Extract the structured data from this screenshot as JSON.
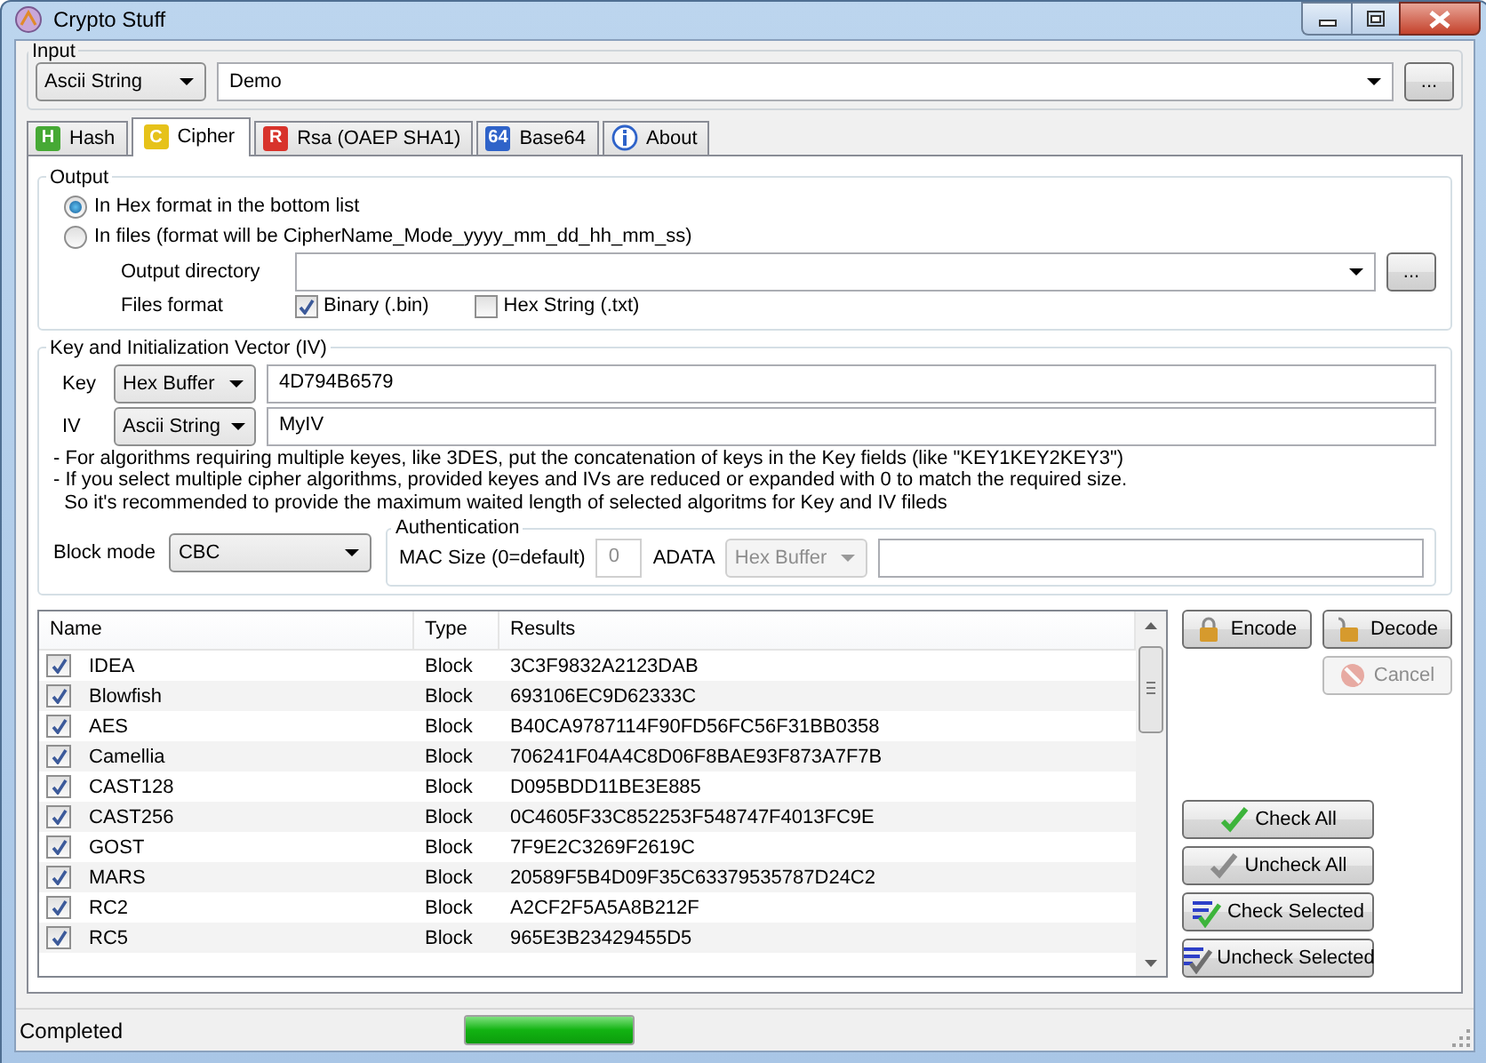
{
  "window": {
    "title": "Crypto Stuff"
  },
  "input": {
    "title": "Input",
    "format": "Ascii String",
    "value": "Demo",
    "browse": "..."
  },
  "tabs": [
    {
      "label": "Hash",
      "badge": "H",
      "kind": "letter",
      "color": "#46a935",
      "selected": false
    },
    {
      "label": "Cipher",
      "badge": "C",
      "kind": "letter",
      "color": "#e6c21a",
      "selected": true
    },
    {
      "label": "Rsa (OAEP SHA1)",
      "badge": "R",
      "kind": "letter",
      "color": "#d8332b",
      "selected": false
    },
    {
      "label": "Base64",
      "badge": "64",
      "kind": "letter",
      "color": "#2f63c9",
      "selected": false
    },
    {
      "label": "About",
      "kind": "info",
      "color": "#2f63c9",
      "selected": false
    }
  ],
  "output": {
    "title": "Output",
    "options": [
      {
        "label": "In Hex format in the bottom list",
        "selected": true
      },
      {
        "label": "In files (format will be CipherName_Mode_yyyy_mm_dd_hh_mm_ss)",
        "selected": false
      }
    ],
    "directory_label": "Output directory",
    "browse": "...",
    "files_format_label": "Files format",
    "formats": [
      {
        "label": "Binary (.bin)",
        "checked": true
      },
      {
        "label": "Hex String (.txt)",
        "checked": false
      }
    ]
  },
  "key_iv": {
    "title": "Key and Initialization Vector (IV)",
    "rows": [
      {
        "label": "Key",
        "format": "Hex Buffer",
        "value": "4D794B6579"
      },
      {
        "label": "IV",
        "format": "Ascii String",
        "value": "MyIV"
      }
    ],
    "notes": [
      "- For algorithms requiring multiple keyes, like 3DES, put the concatenation of keys in the Key fields (like \"KEY1KEY2KEY3\")",
      "- If you select multiple cipher algorithms, provided keyes and IVs are reduced or expanded with 0 to match the required size.",
      "  So it's recommended to provide the maximum waited length of selected algoritms for Key and IV fileds"
    ],
    "block_mode_label": "Block mode",
    "block_mode": "CBC",
    "authentication": {
      "title": "Authentication",
      "mac_label": "MAC Size (0=default)",
      "mac_value": "0",
      "adata_label": "ADATA",
      "adata_format": "Hex Buffer",
      "disabled": true
    }
  },
  "table": {
    "columns": [
      "Name",
      "Type",
      "Results"
    ],
    "rows": [
      {
        "name": "IDEA",
        "checked": true,
        "type": "Block",
        "result": "3C3F9832A2123DAB"
      },
      {
        "name": "Blowfish",
        "checked": true,
        "type": "Block",
        "result": "693106EC9D62333C"
      },
      {
        "name": "AES",
        "checked": true,
        "type": "Block",
        "result": "B40CA9787114F90FD56FC56F31BB0358"
      },
      {
        "name": "Camellia",
        "checked": true,
        "type": "Block",
        "result": "706241F04A4C8D06F8BAE93F873A7F7B"
      },
      {
        "name": "CAST128",
        "checked": true,
        "type": "Block",
        "result": "D095BDD11BE3E885"
      },
      {
        "name": "CAST256",
        "checked": true,
        "type": "Block",
        "result": "0C4605F33C852253F548747F4013FC9E"
      },
      {
        "name": "GOST",
        "checked": true,
        "type": "Block",
        "result": "7F9E2C3269F2619C"
      },
      {
        "name": "MARS",
        "checked": true,
        "type": "Block",
        "result": "20589F5B4D09F35C63379535787D24C2"
      },
      {
        "name": "RC2",
        "checked": true,
        "type": "Block",
        "result": "A2CF2F5A5A8B212F"
      },
      {
        "name": "RC5",
        "checked": true,
        "type": "Block",
        "result": "965E3B23429455D5"
      }
    ]
  },
  "actions": [
    {
      "label": "Encode",
      "kind": "lock",
      "disabled": false
    },
    {
      "label": "Decode",
      "kind": "unlock",
      "disabled": false
    },
    {
      "label": "Cancel",
      "kind": "cancel",
      "disabled": true
    }
  ],
  "selection_buttons": [
    {
      "label": "Check All",
      "kind": "check"
    },
    {
      "label": "Uncheck All",
      "kind": "uncheck"
    },
    {
      "label": "Check Selected",
      "kind": "check-selected"
    },
    {
      "label": "Uncheck Selected",
      "kind": "uncheck-selected"
    }
  ],
  "status_bar": {
    "text": "Completed",
    "level": 1
  }
}
